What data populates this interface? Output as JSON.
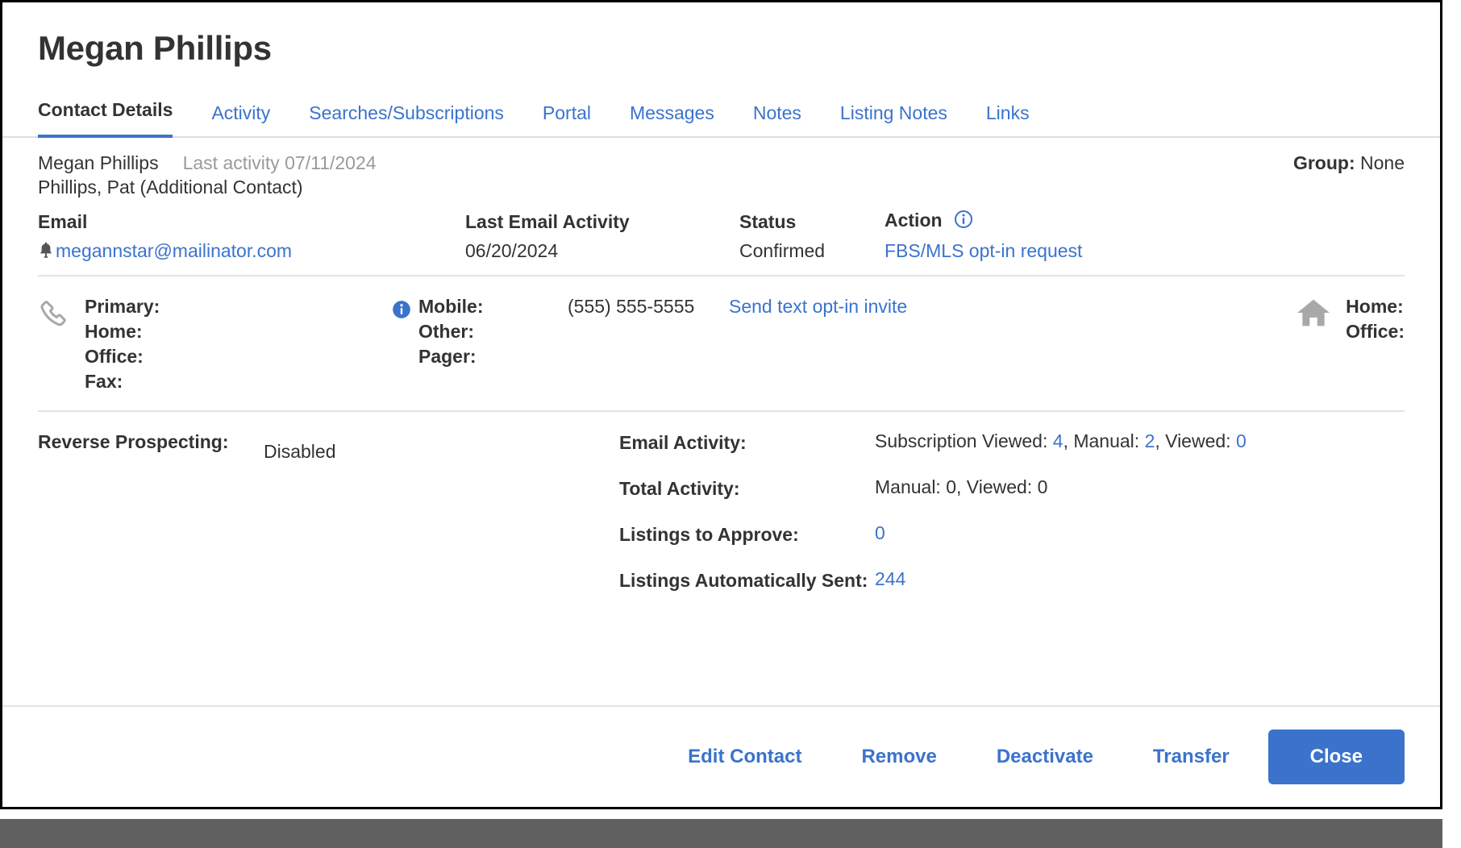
{
  "window": {
    "title": "Megan Phillips"
  },
  "tabs": [
    {
      "label": "Contact Details",
      "active": true
    },
    {
      "label": "Activity",
      "active": false
    },
    {
      "label": "Searches/Subscriptions",
      "active": false
    },
    {
      "label": "Portal",
      "active": false
    },
    {
      "label": "Messages",
      "active": false
    },
    {
      "label": "Notes",
      "active": false
    },
    {
      "label": "Listing Notes",
      "active": false
    },
    {
      "label": "Links",
      "active": false
    }
  ],
  "summary": {
    "primary_name": "Megan Phillips",
    "last_activity": "Last activity 07/11/2024",
    "additional_contact": "Phillips, Pat (Additional Contact)",
    "group_label": "Group:",
    "group_value": "None"
  },
  "email_table": {
    "headers": {
      "email": "Email",
      "last_email_activity": "Last Email Activity",
      "status": "Status",
      "action": "Action"
    },
    "row": {
      "email": "megannstar@mailinator.com",
      "last_email_activity": "06/20/2024",
      "status": "Confirmed",
      "action": "FBS/MLS opt-in request"
    }
  },
  "phones": {
    "left_column": {
      "primary": "Primary:",
      "home": "Home:",
      "office": "Office:",
      "fax": "Fax:"
    },
    "middle_column": {
      "mobile": "Mobile:",
      "other": "Other:",
      "pager": "Pager:"
    },
    "values": {
      "mobile": "(555) 555-5555"
    },
    "text_optin_link": "Send text opt-in invite",
    "address_column": {
      "home": "Home:",
      "office": "Office:"
    }
  },
  "details": {
    "reverse_prospecting_label": "Reverse Prospecting:",
    "reverse_prospecting_value": "Disabled",
    "email_activity_label": "Email Activity:",
    "email_activity": {
      "subscription_viewed_label": "Subscription Viewed:",
      "subscription_viewed_value": "4",
      "manual_label": "Manual:",
      "manual_value": "2",
      "viewed_label": "Viewed:",
      "viewed_value": "0",
      "separator1": ",",
      "separator2": ","
    },
    "total_activity_label": "Total Activity:",
    "total_activity_value": "Manual: 0, Viewed: 0",
    "listings_to_approve_label": "Listings to Approve:",
    "listings_to_approve_value": "0",
    "listings_auto_sent_label": "Listings Automatically Sent:",
    "listings_auto_sent_value": "244"
  },
  "footer": {
    "edit_contact": "Edit Contact",
    "remove": "Remove",
    "deactivate": "Deactivate",
    "transfer": "Transfer",
    "close": "Close"
  },
  "icons": {
    "bell": "bell-icon",
    "info": "info-icon",
    "phone": "phone-icon",
    "home": "home-icon"
  },
  "colors": {
    "link": "#3b73cc",
    "text": "#333333",
    "muted": "#9a9a9a",
    "rule": "#e3e3e3",
    "primary_button": "#3b73cc"
  }
}
